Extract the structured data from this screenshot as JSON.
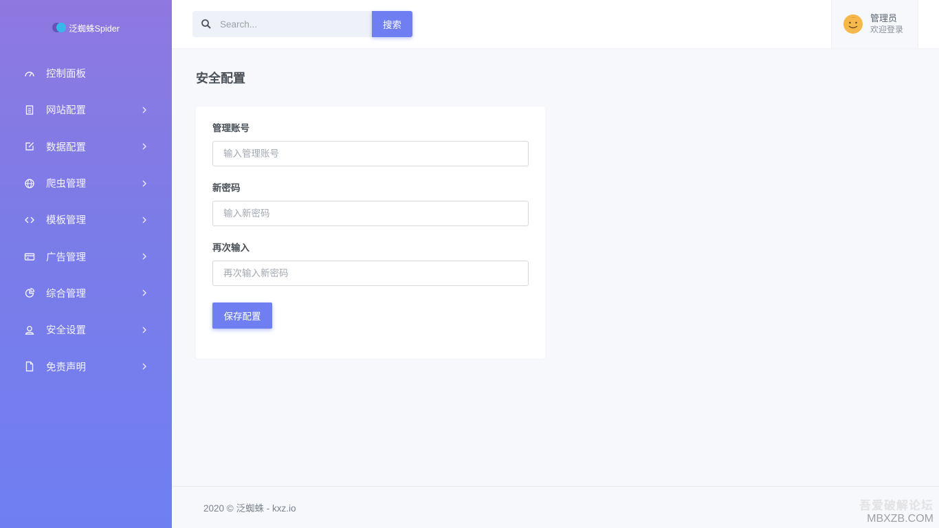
{
  "brand": {
    "name": "泛蜘蛛Spider"
  },
  "sidebar": {
    "items": [
      {
        "label": "控制面板",
        "icon": "gauge-icon",
        "has_chevron": false
      },
      {
        "label": "网站配置",
        "icon": "document-icon",
        "has_chevron": true
      },
      {
        "label": "数据配置",
        "icon": "edit-icon",
        "has_chevron": true
      },
      {
        "label": "爬虫管理",
        "icon": "globe-icon",
        "has_chevron": true
      },
      {
        "label": "模板管理",
        "icon": "code-icon",
        "has_chevron": true
      },
      {
        "label": "广告管理",
        "icon": "credit-card-icon",
        "has_chevron": true
      },
      {
        "label": "综合管理",
        "icon": "pie-chart-icon",
        "has_chevron": true
      },
      {
        "label": "安全设置",
        "icon": "user-icon",
        "has_chevron": true
      },
      {
        "label": "免责声明",
        "icon": "file-icon",
        "has_chevron": true
      }
    ]
  },
  "header": {
    "search": {
      "placeholder": "Search...",
      "button_label": "搜索"
    },
    "user": {
      "name": "管理员",
      "subtitle": "欢迎登录"
    }
  },
  "main": {
    "title": "安全配置",
    "form": {
      "account": {
        "label": "管理账号",
        "placeholder": "输入管理账号",
        "value": ""
      },
      "new_password": {
        "label": "新密码",
        "placeholder": "输入新密码",
        "value": ""
      },
      "confirm_password": {
        "label": "再次输入",
        "placeholder": "再次输入新密码",
        "value": ""
      },
      "save_label": "保存配置"
    }
  },
  "footer": {
    "text": "2020 © 泛蜘蛛 - kxz.io"
  },
  "watermark": {
    "line1": "吾爱破解论坛",
    "line2": "MBXZB.COM"
  },
  "colors": {
    "accent": "#6f7ff2",
    "sidebar_top": "#8f78e0",
    "sidebar_bottom": "#6f7ff2",
    "background": "#f7f8fc"
  }
}
